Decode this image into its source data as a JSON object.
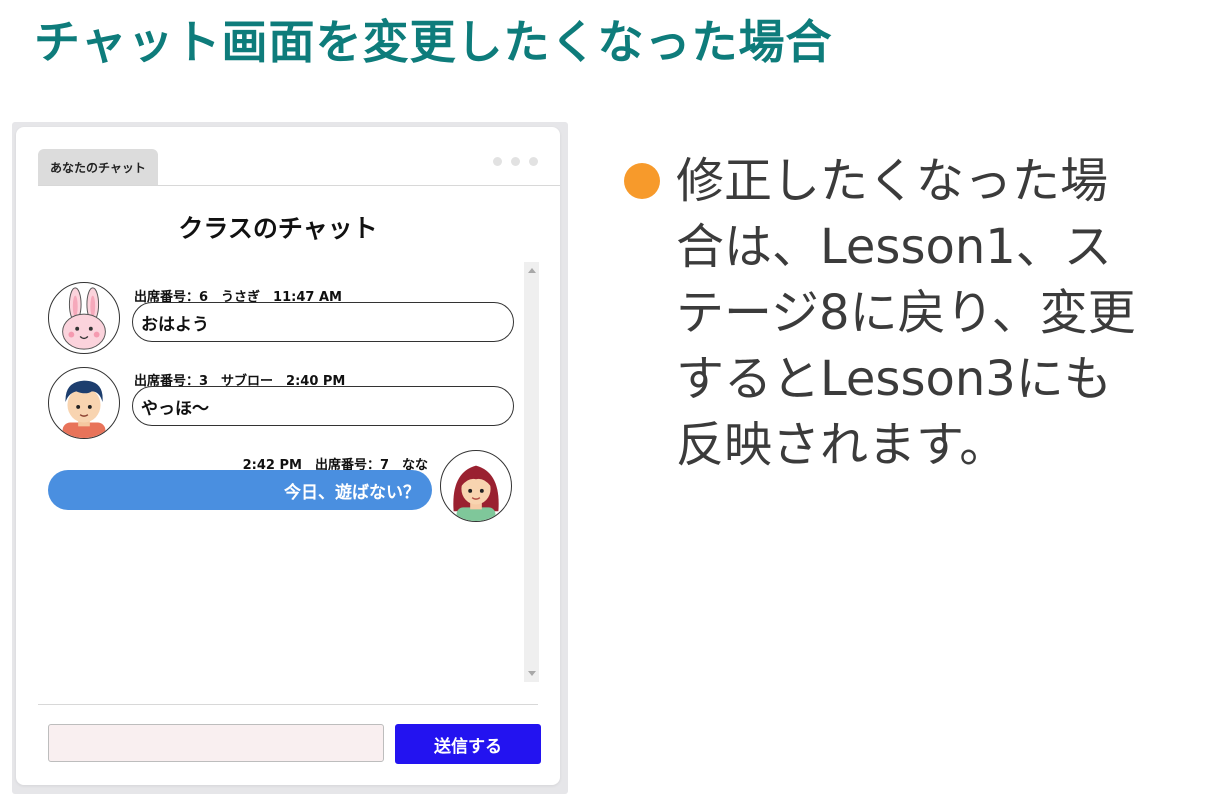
{
  "slide": {
    "title": "チャット画面を変更したくなった場合"
  },
  "chat": {
    "tab_label": "あなたのチャット",
    "title": "クラスのチャット",
    "messages": [
      {
        "meta": "出席番号：6　うさぎ　11:47 AM",
        "text": "おはよう",
        "avatar_icon": "rabbit-avatar-icon"
      },
      {
        "meta": "出席番号：3　サブロー　2:40 PM",
        "text": "やっほ〜",
        "avatar_icon": "boy-avatar-icon"
      },
      {
        "meta": "2:42 PM　出席番号：7　なな",
        "text": "今日、遊ばない？",
        "avatar_icon": "girl-avatar-icon"
      }
    ],
    "input_placeholder": "",
    "send_label": "送信する"
  },
  "bullet": {
    "lines": [
      "修正したくなった場",
      "合は、Lesson1、ス",
      "テージ8に戻り、変更",
      "するとLesson3にも",
      "反映されます。"
    ]
  },
  "colors": {
    "title": "#0e7c7b",
    "send_button": "#2313f0",
    "self_bubble": "#4a8fe0",
    "bullet_dot": "#f79a2b"
  }
}
